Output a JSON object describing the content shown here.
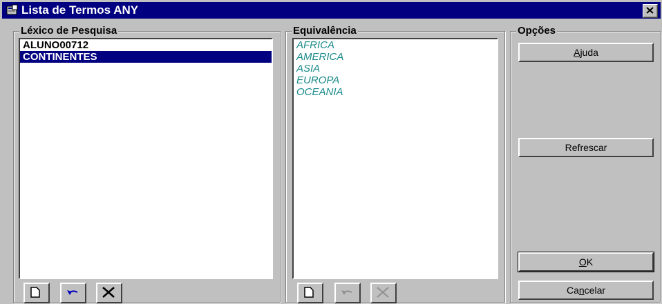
{
  "window": {
    "title": "Lista de Termos ANY"
  },
  "lexico": {
    "label": "Léxico de Pesquisa",
    "items": [
      "ALUNO00712",
      "CONTINENTES"
    ],
    "selected_index": 1
  },
  "equivalencia": {
    "label": "Equivalência",
    "items": [
      "AFRICA",
      "AMERICA",
      "ASIA",
      "EUROPA",
      "OCEANIA"
    ]
  },
  "opcoes": {
    "label": "Opções",
    "ajuda": {
      "pre": "",
      "accel": "A",
      "post": "juda"
    },
    "refrescar": "Refrescar",
    "ok": {
      "pre": "",
      "accel": "O",
      "post": "K"
    },
    "cancelar": {
      "pre": "Ca",
      "accel": "n",
      "post": "celar"
    }
  },
  "colors": {
    "title_bar": "#000080",
    "selection": "#000080",
    "equivalence_text": "#1a8a8a"
  }
}
